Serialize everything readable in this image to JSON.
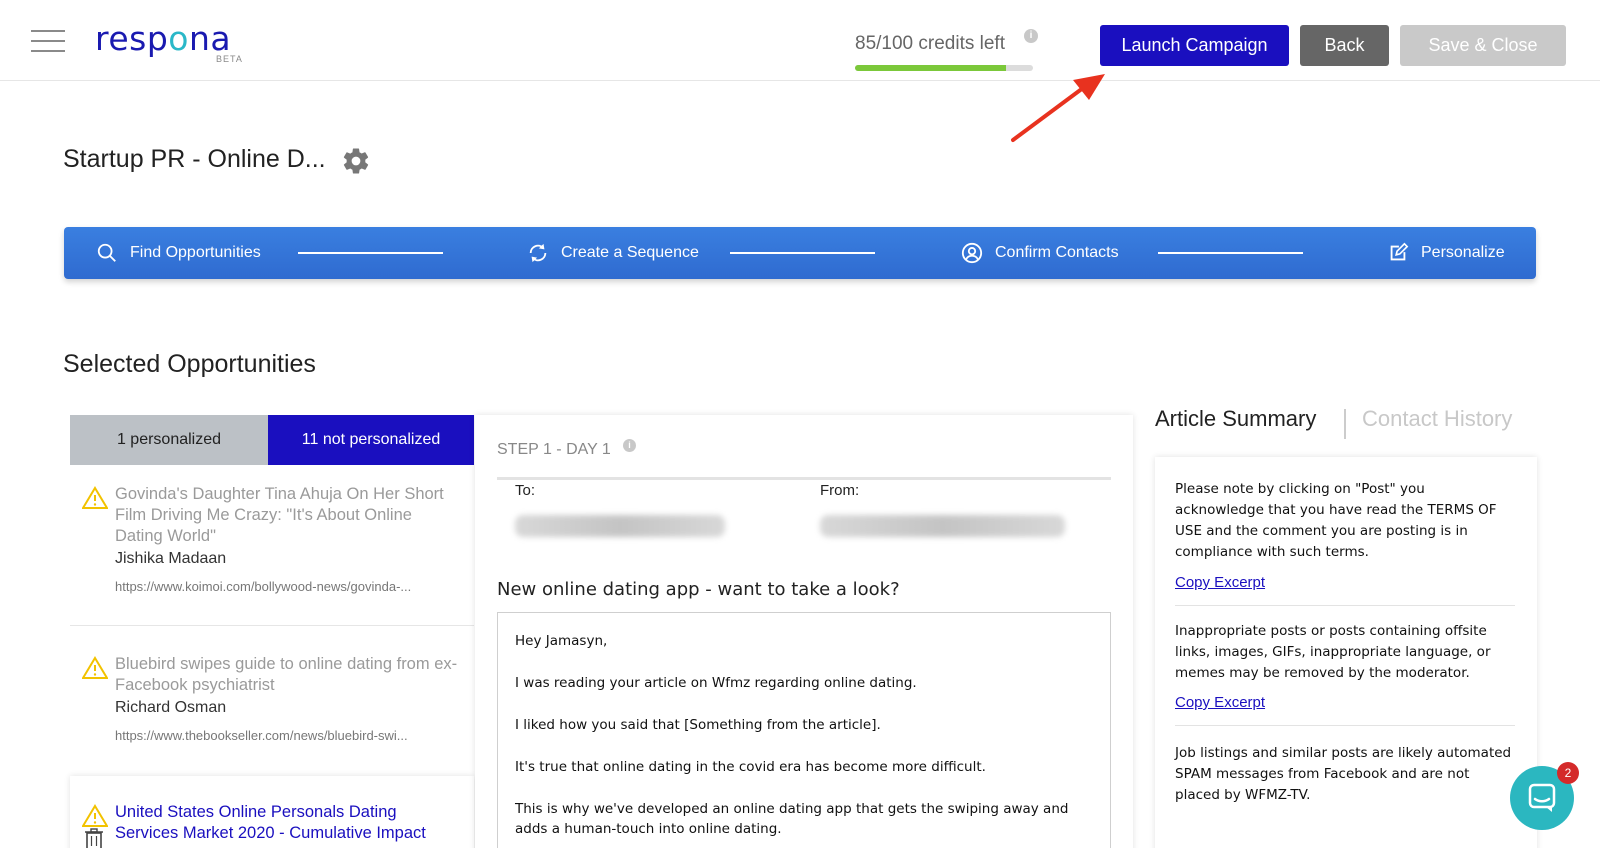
{
  "header": {
    "logo_text": "respona",
    "logo_badge": "BETA",
    "credits_text": "85/100 credits left",
    "credits_used_fraction": 0.85,
    "launch_label": "Launch Campaign",
    "back_label": "Back",
    "save_label": "Save & Close"
  },
  "campaign": {
    "title": "Startup PR - Online D..."
  },
  "stepper": {
    "steps": [
      {
        "label": "Find Opportunities",
        "icon": "search-icon"
      },
      {
        "label": "Create a Sequence",
        "icon": "refresh-icon"
      },
      {
        "label": "Confirm Contacts",
        "icon": "user-circle-icon"
      },
      {
        "label": "Personalize",
        "icon": "edit-icon"
      }
    ]
  },
  "opportunities": {
    "heading": "Selected Opportunities",
    "tab_personalized": "1 personalized",
    "tab_not_personalized": "11 not personalized",
    "items": [
      {
        "title": "Govinda's Daughter Tina Ahuja On Her Short Film Driving Me Crazy: \"It's About Online Dating World\"",
        "author": "Jishika Madaan",
        "url": "https://www.koimoi.com/bollywood-news/govinda-..."
      },
      {
        "title": "Bluebird swipes guide to online dating from ex-Facebook psychiatrist",
        "author": "Richard Osman",
        "url": "https://www.thebookseller.com/news/bluebird-swi..."
      },
      {
        "title": "United States Online Personals Dating Services Market 2020 - Cumulative Impact",
        "author": "",
        "url": ""
      }
    ]
  },
  "email": {
    "step_label": "STEP 1 - DAY 1",
    "to_label": "To:",
    "from_label": "From:",
    "subject": "New online dating app - want to take a look?",
    "body": [
      "Hey Jamasyn,",
      "I was reading your article on Wfmz regarding online dating.",
      "I liked how you said that [Something from the article].",
      "It's true that online dating in the covid era has become more difficult.",
      "This is why we've developed an online dating app that  gets the swiping away and adds a human-touch into online dating."
    ]
  },
  "summary": {
    "tab_summary": "Article Summary",
    "tab_history": "Contact History",
    "excerpts": [
      "Please note by clicking on \"Post\" you acknowledge that you have read the TERMS OF USE and the comment you are posting is in compliance with such terms.",
      "Inappropriate posts or posts containing offsite links, images, GIFs, inappropriate language, or memes may be removed by the moderator.",
      "Job listings and similar posts are likely automated SPAM messages from Facebook and are not placed by WFMZ-TV."
    ],
    "copy_label": "Copy Excerpt"
  },
  "chat": {
    "badge_count": "2"
  },
  "colors": {
    "brand_blue": "#1a0fbf",
    "stepper_blue": "#3a7fe0",
    "teal": "#2bb7c0",
    "warning_yellow": "#f2c200",
    "progress_green": "#7bc83a",
    "annotation_red": "#e8321f"
  }
}
